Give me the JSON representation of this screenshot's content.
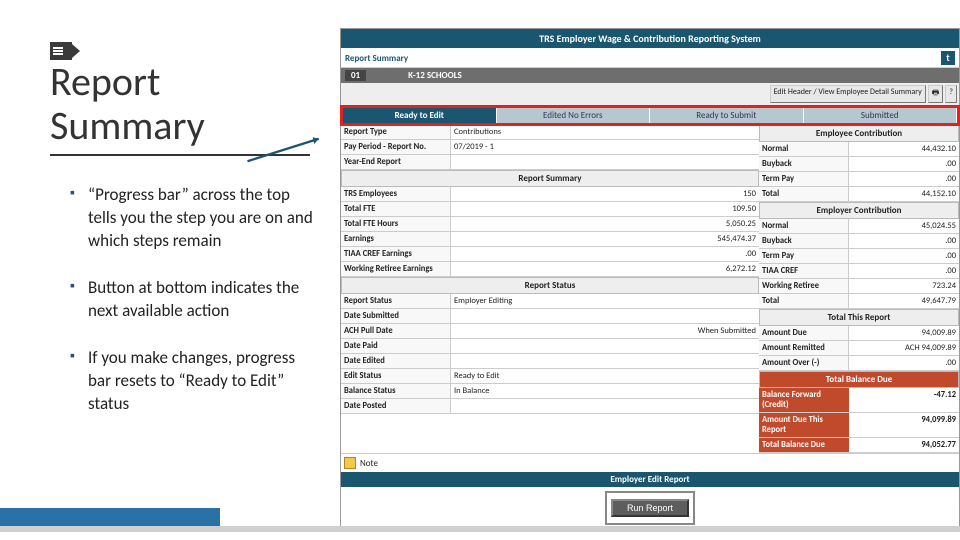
{
  "slide": {
    "title": "Report Summary",
    "bullets": [
      "“Progress bar” across the top tells you the step you are on and which steps remain",
      "Button at bottom indicates the next available action",
      "If you make changes, progress bar resets to “Ready to Edit” status"
    ]
  },
  "app": {
    "header": "TRS Employer Wage & Contribution Reporting System",
    "sub_title": "Report Summary",
    "school_code": "01",
    "school_name": "K-12 SCHOOLS",
    "actions": {
      "edit_header": "Edit Header / View Employee Detail Summary",
      "print_icon": "print-icon",
      "help_icon": "help-icon"
    },
    "progress": [
      {
        "label": "Ready to Edit",
        "active": true
      },
      {
        "label": "Edited No Errors",
        "active": false
      },
      {
        "label": "Ready to Submit",
        "active": false
      },
      {
        "label": "Submitted",
        "active": false
      }
    ],
    "report_type": {
      "label": "Report Type",
      "value": "Contributions"
    },
    "pay_period": {
      "label": "Pay Period - Report No.",
      "value": "07/2019 - 1"
    },
    "year_end": {
      "label": "Year-End Report",
      "value": ""
    },
    "report_summary": [
      {
        "label": "TRS Employees",
        "value": "150"
      },
      {
        "label": "Total FTE",
        "value": "109.50"
      },
      {
        "label": "Total FTE Hours",
        "value": "5,050.25"
      },
      {
        "label": "Earnings",
        "value": "545,474.37"
      },
      {
        "label": "TIAA CREF Earnings",
        "value": ".00"
      },
      {
        "label": "Working Retiree Earnings",
        "value": "6,272.12"
      }
    ],
    "report_status": [
      {
        "label": "Report Status",
        "value": "Employer Editing"
      },
      {
        "label": "Date Submitted",
        "value": ""
      },
      {
        "label": "ACH Pull Date",
        "value": "When Submitted"
      },
      {
        "label": "Date Paid",
        "value": ""
      },
      {
        "label": "Date Edited",
        "value": ""
      },
      {
        "label": "Edit Status",
        "value": "Ready to Edit"
      },
      {
        "label": "Balance Status",
        "value": "In Balance"
      },
      {
        "label": "Date Posted",
        "value": ""
      }
    ],
    "emp_contrib": {
      "title": "Employee Contribution",
      "rows": [
        {
          "label": "Normal",
          "value": "44,432.10"
        },
        {
          "label": "Buyback",
          "value": ".00"
        },
        {
          "label": "Term Pay",
          "value": ".00"
        },
        {
          "label": "Total",
          "value": "44,152.10"
        }
      ]
    },
    "employer_contrib": {
      "title": "Employer Contribution",
      "rows": [
        {
          "label": "Normal",
          "value": "45,024.55"
        },
        {
          "label": "Buyback",
          "value": ".00"
        },
        {
          "label": "Term Pay",
          "value": ".00"
        },
        {
          "label": "TIAA CREF",
          "value": ".00"
        },
        {
          "label": "Working Retiree",
          "value": "723.24"
        },
        {
          "label": "Total",
          "value": "49,647.79"
        }
      ]
    },
    "total_this_report": {
      "title": "Total This Report",
      "rows": [
        {
          "label": "Amount Due",
          "value": "94,009.89"
        },
        {
          "label": "Amount Remitted",
          "value": "ACH  94,009.89"
        },
        {
          "label": "Amount Over (-)",
          "value": ".00"
        }
      ]
    },
    "total_balance_due": {
      "title": "Total Balance Due",
      "rows": [
        {
          "label": "Balance Forward  (Credit)",
          "value": "-47.12"
        },
        {
          "label": "Amount Due This Report",
          "value": "94,099.89"
        },
        {
          "label": "Total Balance Due",
          "value": "94,052.77"
        }
      ]
    },
    "note_label": "Note",
    "edit_report_bar": "Employer Edit Report",
    "run_button": "Run Report"
  }
}
